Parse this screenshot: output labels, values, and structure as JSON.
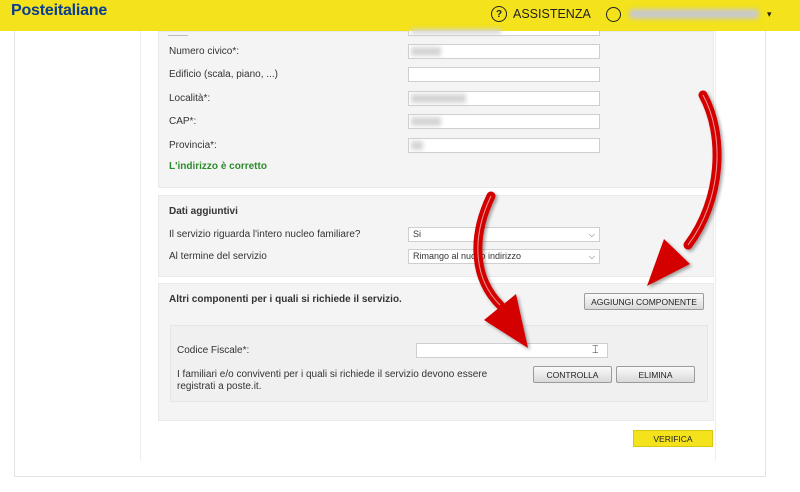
{
  "header": {
    "logo_bold": "Poste",
    "logo_rest": "italiane",
    "help_icon_glyph": "?",
    "assistance_label": "ASSISTENZA",
    "user_caret": "▾"
  },
  "address": {
    "civic_label": "Numero civico*:",
    "building_label": "Edificio (scala, piano, ...)",
    "locality_label": "Località*:",
    "cap_label": "CAP*:",
    "province_label": "Provincia*:",
    "valid_message": "L'indirizzo è corretto"
  },
  "additional": {
    "title": "Dati aggiuntivi",
    "family_label": "Il servizio riguarda l'intero nucleo familiare?",
    "family_value": "Si",
    "after_label": "Al termine del servizio",
    "after_value": "Rimango al nuovo indirizzo"
  },
  "components": {
    "title": "Altri componenti per i quali si richiede il servizio.",
    "add_button": "AGGIUNGI COMPONENTE",
    "fiscal_code_label": "Codice Fiscale*:",
    "fiscal_code_value": "",
    "note_line1": "I familiari e/o conviventi per i quali si richiede il servizio devono essere",
    "note_line2": "registrati a poste.it.",
    "check_button": "CONTROLLA",
    "delete_button": "ELIMINA"
  },
  "footer": {
    "verify_button": "VERIFICA"
  },
  "colors": {
    "brand_yellow": "#f3e21c",
    "brand_blue": "#0b3d91",
    "success_green": "#2e8b2e",
    "arrow_red": "#d40000"
  }
}
